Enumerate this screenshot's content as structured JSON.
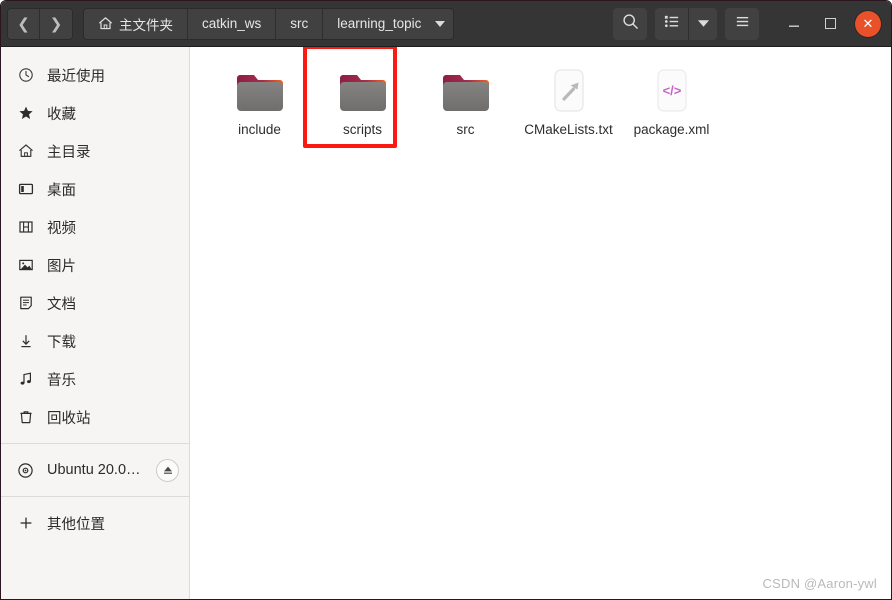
{
  "window": {
    "title": "learning_topic",
    "close_label": "✕",
    "minimize_label": "—",
    "maximize_label": ""
  },
  "header": {
    "back_label": "❮",
    "forward_label": "❯",
    "back_icon": "chevron-left-icon",
    "forward_icon": "chevron-right-icon",
    "breadcrumbs": [
      {
        "label": "主文件夹",
        "icon": "home-icon",
        "current": false
      },
      {
        "label": "catkin_ws",
        "icon": "",
        "current": false
      },
      {
        "label": "src",
        "icon": "",
        "current": false
      },
      {
        "label": "learning_topic",
        "icon": "",
        "current": true
      }
    ],
    "buttons": [
      {
        "name": "search-button",
        "icon": "search-icon",
        "label": ""
      },
      {
        "name": "view-list-button",
        "icon": "list-view-icon",
        "label": ""
      },
      {
        "name": "view-options-dropdown",
        "icon": "chevron-down-icon",
        "label": ""
      },
      {
        "name": "main-menu-button",
        "icon": "hamburger-menu-icon",
        "label": ""
      }
    ]
  },
  "sidebar": {
    "items": [
      {
        "label": "最近使用",
        "icon": "clock-icon",
        "name": "sidebar-item-recent"
      },
      {
        "label": "收藏",
        "icon": "star-icon",
        "name": "sidebar-item-starred"
      },
      {
        "label": "主目录",
        "icon": "home-icon",
        "name": "sidebar-item-home"
      },
      {
        "label": "桌面",
        "icon": "desktop-icon",
        "name": "sidebar-item-desktop"
      },
      {
        "label": "视频",
        "icon": "video-icon",
        "name": "sidebar-item-videos"
      },
      {
        "label": "图片",
        "icon": "image-icon",
        "name": "sidebar-item-pictures"
      },
      {
        "label": "文档",
        "icon": "document-icon",
        "name": "sidebar-item-documents"
      },
      {
        "label": "下载",
        "icon": "download-icon",
        "name": "sidebar-item-downloads"
      },
      {
        "label": "音乐",
        "icon": "music-icon",
        "name": "sidebar-item-music"
      },
      {
        "label": "回收站",
        "icon": "trash-icon",
        "name": "sidebar-item-trash"
      }
    ],
    "device": {
      "label": "Ubuntu 20.0…",
      "icon": "disc-icon",
      "eject_icon": "eject-icon",
      "name": "sidebar-item-ubuntu-drive"
    },
    "other_locations": {
      "label": "其他位置",
      "icon": "plus-icon",
      "name": "sidebar-item-other-locations"
    }
  },
  "main": {
    "files": [
      {
        "label": "include",
        "type": "folder",
        "icon": "folder-icon",
        "selected": false
      },
      {
        "label": "scripts",
        "type": "folder",
        "icon": "folder-icon",
        "selected": true
      },
      {
        "label": "src",
        "type": "folder",
        "icon": "folder-icon",
        "selected": false
      },
      {
        "label": "CMakeLists.txt",
        "type": "file",
        "icon": "hammer-build-file-icon",
        "selected": false
      },
      {
        "label": "package.xml",
        "type": "file",
        "icon": "code-xml-file-icon",
        "selected": false
      }
    ],
    "highlight_target": "scripts",
    "highlight_color": "#fb1a11"
  },
  "watermark": {
    "text": "CSDN @Aaron-ywl"
  },
  "colors": {
    "headerbar": "#353535",
    "sidebar": "#f6f5f4",
    "content": "#ffffff",
    "close_button": "#e8512a",
    "folder_body": "#7b7a78",
    "folder_tab": "#9c2a4e",
    "folder_accent": "#f4641e",
    "xml_glyph": "#c663c8"
  }
}
